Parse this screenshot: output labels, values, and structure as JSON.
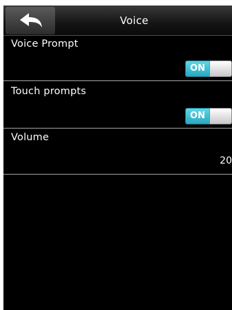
{
  "header": {
    "title": "Voice"
  },
  "settings": [
    {
      "label": "Voice Prompt",
      "toggle_label": "ON",
      "state": "on"
    },
    {
      "label": "Touch prompts",
      "toggle_label": "ON",
      "state": "on"
    },
    {
      "label": "Volume",
      "value": "20"
    }
  ],
  "colors": {
    "toggle_on": "#2fb3c8",
    "background": "#000000",
    "divider": "#a5a5a5"
  },
  "icons": {
    "back": "back-arrow-icon"
  }
}
